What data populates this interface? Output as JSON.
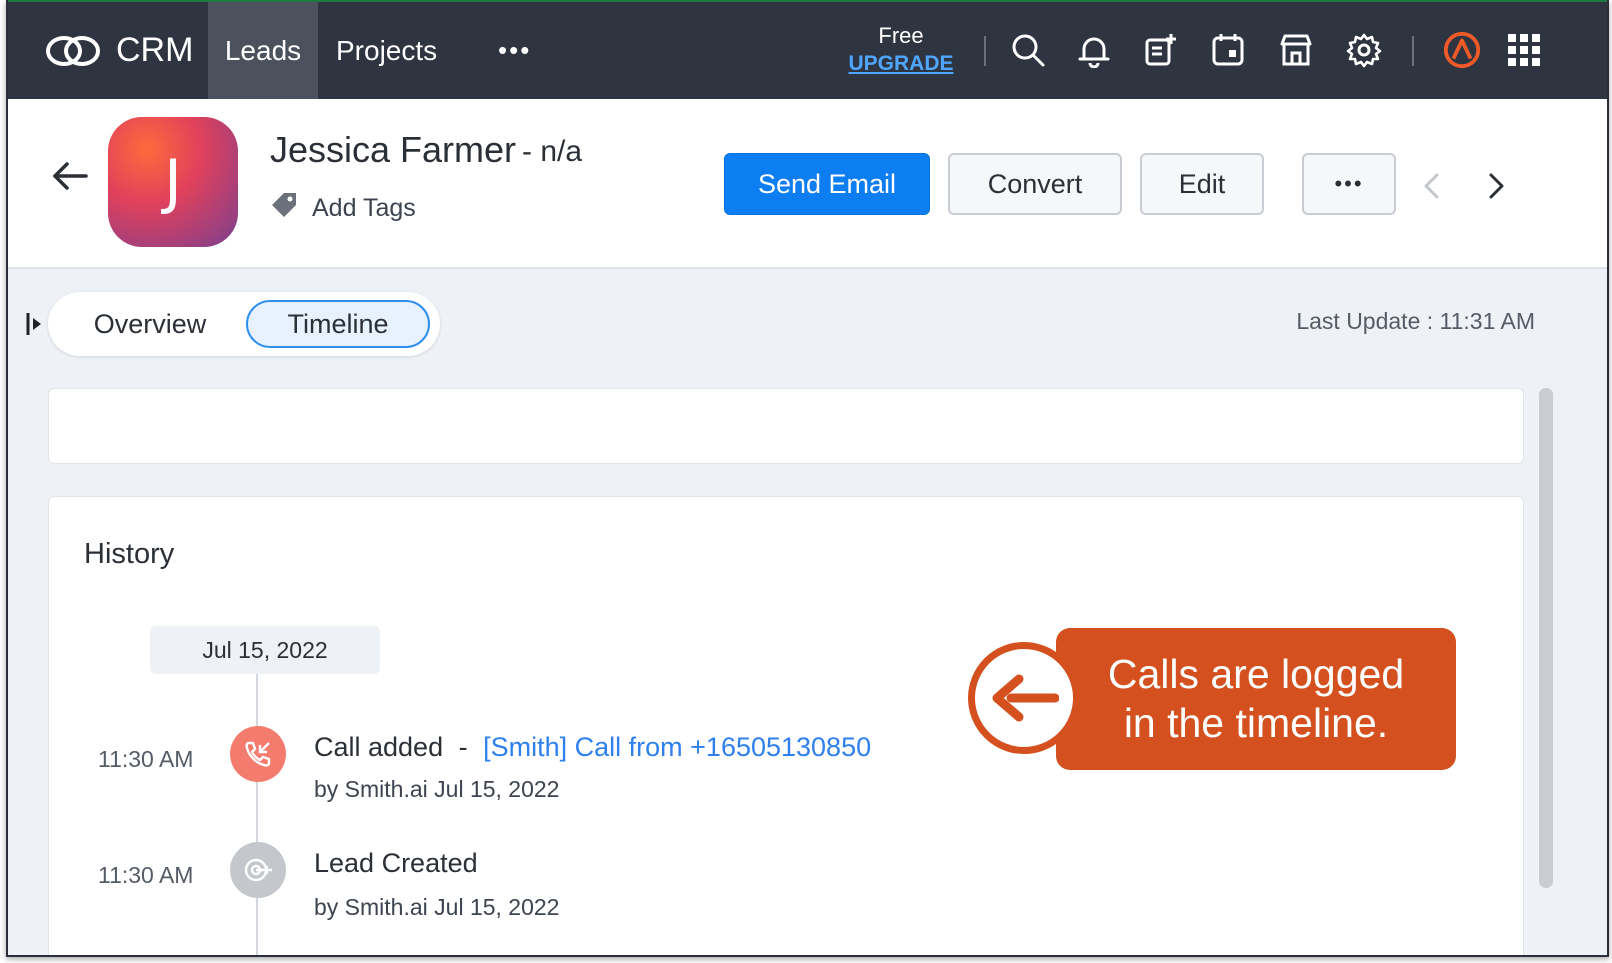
{
  "app": {
    "name": "CRM"
  },
  "nav": {
    "tabs": [
      {
        "label": "Leads"
      },
      {
        "label": "Projects"
      }
    ],
    "more": "•••"
  },
  "plan": {
    "tier": "Free",
    "upgrade": "UPGRADE"
  },
  "topbar_icons": [
    "search-icon",
    "bell-icon",
    "add-note-icon",
    "calendar-icon",
    "store-icon",
    "gear-icon",
    "brand-logo-icon",
    "app-grid-icon"
  ],
  "lead": {
    "avatar_initial": "J",
    "name": "Jessica Farmer",
    "subtitle": "- n/a",
    "add_tags": "Add Tags"
  },
  "actions": {
    "send_email": "Send Email",
    "convert": "Convert",
    "edit": "Edit",
    "more": "•••"
  },
  "view_tabs": {
    "overview": "Overview",
    "timeline": "Timeline",
    "active": "Timeline"
  },
  "last_update": "Last Update : 11:31 AM",
  "history": {
    "title": "History",
    "date": "Jul 15, 2022",
    "events": [
      {
        "time": "11:30 AM",
        "title": "Call added",
        "separator": "-",
        "link": "[Smith] Call from +16505130850",
        "by": "by Smith.ai Jul 15, 2022",
        "icon": "phone-incoming-icon",
        "color": "#f47c6e"
      },
      {
        "time": "11:30 AM",
        "title": "Lead Created",
        "by": "by Smith.ai Jul 15, 2022",
        "icon": "lead-target-icon",
        "color": "#c4c7cc"
      }
    ]
  },
  "callout": {
    "line1": "Calls are logged",
    "line2": "in the timeline.",
    "color": "#d4511f"
  },
  "colors": {
    "topbar": "#2e3440",
    "primary": "#0d7df2",
    "link": "#2f80ed"
  }
}
